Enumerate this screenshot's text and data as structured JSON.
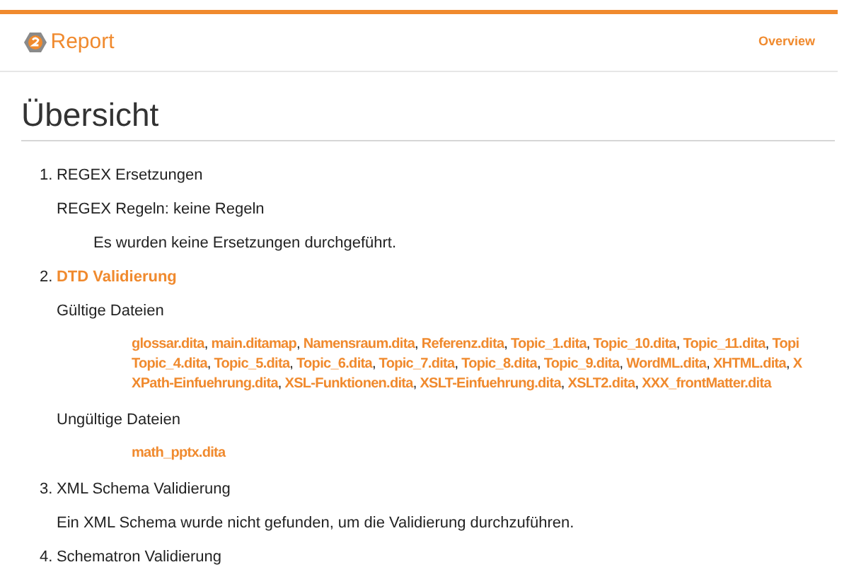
{
  "header": {
    "logo_text": "Report",
    "nav": [
      {
        "label": "Overview"
      }
    ]
  },
  "title": "Übersicht",
  "sections": [
    {
      "number": "1.",
      "title": "REGEX Ersetzungen",
      "highlighted": false,
      "items": [
        {
          "kind": "group",
          "heading": "REGEX Regeln: keine Regeln",
          "children": [
            {
              "kind": "message",
              "text": "Es wurden keine Ersetzungen durchgeführt."
            }
          ]
        }
      ]
    },
    {
      "number": "2.",
      "title": "DTD Validierung",
      "highlighted": true,
      "items": [
        {
          "kind": "group",
          "heading": "Gültige Dateien",
          "children": [
            {
              "kind": "files",
              "separator": ",",
              "lines": [
                [
                  "glossar.dita",
                  "main.ditamap",
                  "Namensraum.dita",
                  "Referenz.dita",
                  "Topic_1.dita",
                  "Topic_10.dita",
                  "Topic_11.dita",
                  "Topi"
                ],
                [
                  "Topic_4.dita",
                  "Topic_5.dita",
                  "Topic_6.dita",
                  "Topic_7.dita",
                  "Topic_8.dita",
                  "Topic_9.dita",
                  "WordML.dita",
                  "XHTML.dita",
                  "X"
                ],
                [
                  "XPath-Einfuehrung.dita",
                  "XSL-Funktionen.dita",
                  "XSLT-Einfuehrung.dita",
                  "XSLT2.dita",
                  "XXX_frontMatter.dita"
                ]
              ]
            }
          ]
        },
        {
          "kind": "group",
          "heading": "Ungültige Dateien",
          "children": [
            {
              "kind": "files",
              "lines": [
                [
                  "math_pptx.dita"
                ]
              ]
            }
          ]
        }
      ]
    },
    {
      "number": "3.",
      "title": "XML Schema Validierung",
      "highlighted": false,
      "items": [
        {
          "kind": "message",
          "text": "Ein XML Schema wurde nicht gefunden, um die Validierung durchzuführen."
        }
      ]
    },
    {
      "number": "4.",
      "title": "Schematron Validierung",
      "highlighted": false
    }
  ]
}
